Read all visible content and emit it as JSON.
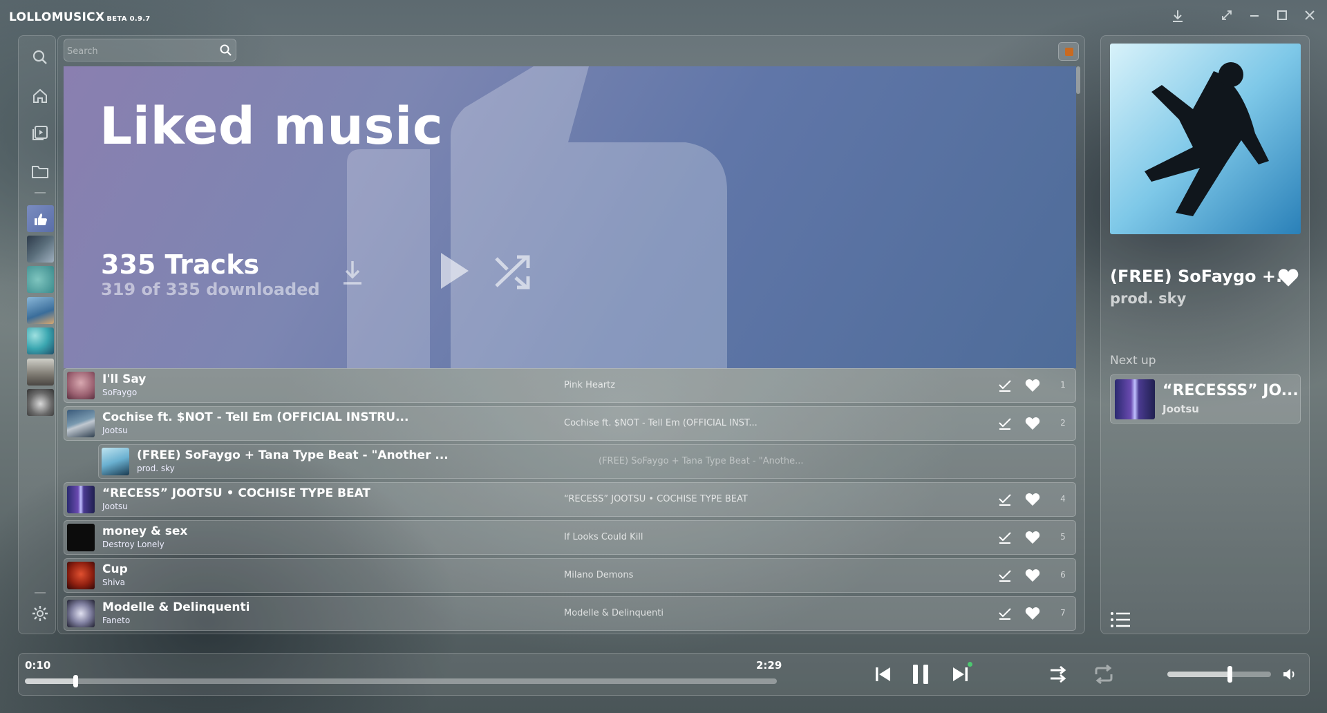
{
  "app": {
    "name": "LOLLOMUSICX",
    "version": "BETA 0.9.7"
  },
  "search": {
    "placeholder": "Search"
  },
  "playlist": {
    "title": "Liked music",
    "track_count": "335 Tracks",
    "downloaded": "319 of 335 downloaded"
  },
  "tracks": [
    {
      "title": "I'll Say",
      "artist": "SoFaygo",
      "album": "Pink Heartz",
      "num": "1",
      "downloaded": true,
      "liked": true
    },
    {
      "title": "Cochise ft. $NOT - Tell Em (OFFICIAL INSTRU...",
      "artist": "Jootsu",
      "album": "Cochise ft. $NOT - Tell Em (OFFICIAL INST...",
      "num": "2",
      "downloaded": true,
      "liked": true
    },
    {
      "title": "(FREE) SoFaygo + Tana Type Beat - \"Another ...",
      "artist": "prod. sky",
      "album": "(FREE) SoFaygo + Tana Type Beat - \"Anothe...",
      "num": "",
      "playing": true
    },
    {
      "title": "“RECESS” JOOTSU • COCHISE TYPE BEAT",
      "artist": "Jootsu",
      "album": "“RECESS” JOOTSU • COCHISE TYPE BEAT",
      "num": "4",
      "downloaded": true,
      "liked": true
    },
    {
      "title": "money & sex",
      "artist": "Destroy Lonely",
      "album": "If Looks Could Kill",
      "num": "5",
      "downloaded": true,
      "liked": true
    },
    {
      "title": "Cup",
      "artist": "Shiva",
      "album": "Milano Demons",
      "num": "6",
      "downloaded": true,
      "liked": true
    },
    {
      "title": "Modelle & Delinquenti",
      "artist": "Faneto",
      "album": "Modelle & Delinquenti",
      "num": "7",
      "downloaded": true,
      "liked": true
    }
  ],
  "now_playing": {
    "title": "(FREE) SoFaygo +...",
    "artist": "prod. sky",
    "liked": true
  },
  "next_up": {
    "label": "Next up",
    "title": "“RECESSS” JO...",
    "artist": "Jootsu"
  },
  "player": {
    "current_time": "0:10",
    "total_time": "2:29",
    "progress": 0.0671,
    "volume": 0.6
  },
  "colors": {
    "hero_start": "#8a7fb0",
    "hero_end": "#4e6c99",
    "notification": "#c96a20"
  }
}
